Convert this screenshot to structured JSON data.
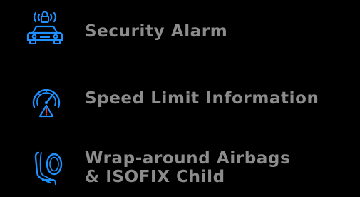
{
  "colors": {
    "background": "#000000",
    "icon_blue": "#1e90ff",
    "icon_red": "#e23b2e",
    "icon_yellow": "#f2c200",
    "label_gray": "#8c8c8c"
  },
  "features": [
    {
      "icon": "car-alarm-icon",
      "label": "Security Alarm"
    },
    {
      "icon": "speedometer-warning-icon",
      "label": "Speed Limit Information"
    },
    {
      "icon": "airbag-seat-icon",
      "label_line1": "Wrap-around Airbags",
      "label_line2": "& ISOFIX Child"
    }
  ]
}
